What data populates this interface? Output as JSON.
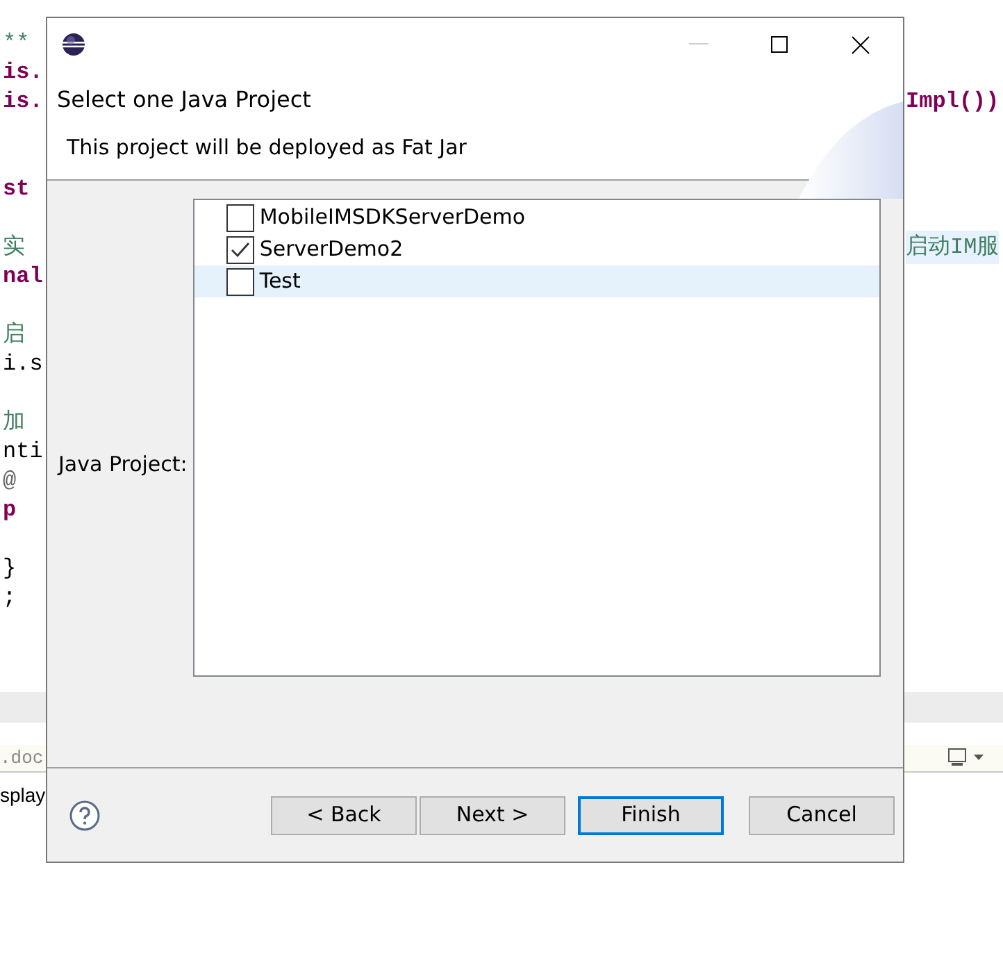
{
  "background_editor": {
    "lines": [
      {
        "kind": "comment",
        "left": "**"
      },
      {
        "kind": "keyword",
        "left": "is."
      },
      {
        "kind": "keyword",
        "left": "is.",
        "right": "Impl())"
      },
      {
        "kind": "blank"
      },
      {
        "kind": "blank"
      },
      {
        "kind": "keyword",
        "left": "st"
      },
      {
        "kind": "blank"
      },
      {
        "kind": "comment",
        "left": "实",
        "right": "启动IM服"
      },
      {
        "kind": "keyword",
        "left": "nal"
      },
      {
        "kind": "blank"
      },
      {
        "kind": "comment",
        "left": "启"
      },
      {
        "kind": "code",
        "left": "i.s"
      },
      {
        "kind": "blank"
      },
      {
        "kind": "comment",
        "left": "加"
      },
      {
        "kind": "code",
        "left": "nti"
      },
      {
        "kind": "annotation",
        "left": "@"
      },
      {
        "kind": "keyword",
        "left": "p"
      },
      {
        "kind": "blank"
      },
      {
        "kind": "code",
        "left": "}"
      },
      {
        "kind": "code",
        "left": ";"
      }
    ],
    "tab_label": ".doc",
    "console_text": "splay"
  },
  "dialog": {
    "title_heading": "Select one Java Project",
    "description": "This project will be deployed as Fat Jar",
    "field_label": "Java Project:",
    "projects": [
      {
        "label": "MobileIMSDKServerDemo",
        "checked": false,
        "selected": false
      },
      {
        "label": "ServerDemo2",
        "checked": true,
        "selected": false
      },
      {
        "label": "Test",
        "checked": false,
        "selected": true
      }
    ],
    "buttons": [
      {
        "label": "< Back",
        "default": false
      },
      {
        "label": "Next >",
        "default": false
      },
      {
        "label": "Finish",
        "default": true
      },
      {
        "label": "Cancel",
        "default": false
      }
    ]
  }
}
